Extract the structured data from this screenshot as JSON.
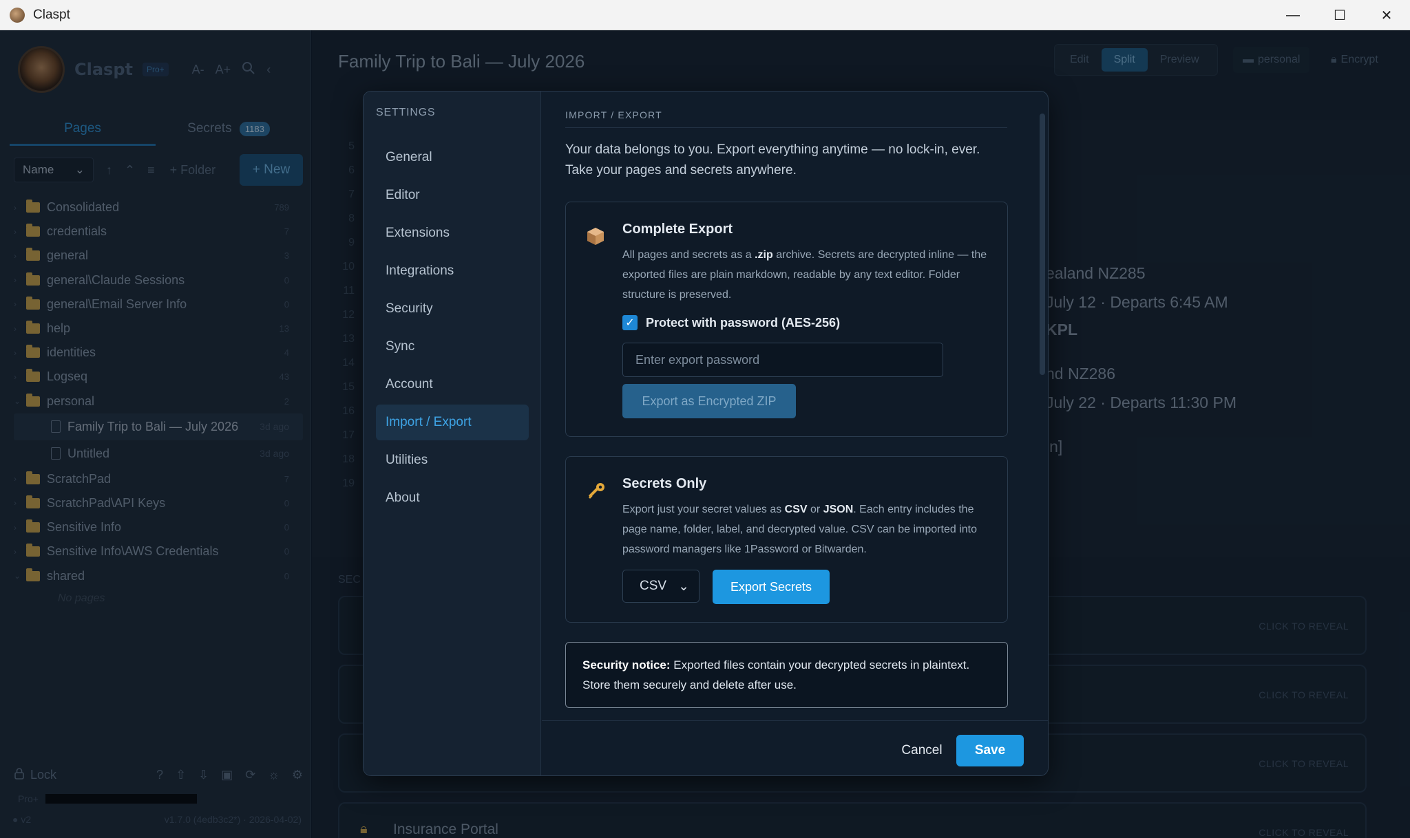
{
  "window": {
    "title": "Claspt",
    "controls": [
      "—",
      "☐",
      "✕"
    ]
  },
  "sidebar": {
    "brand": "Claspt",
    "plan_badge": "Pro+",
    "font_smaller": "A-",
    "font_larger": "A+",
    "tabs": [
      {
        "label": "Pages"
      },
      {
        "label": "Secrets",
        "count": "1183"
      }
    ],
    "sort": {
      "value": "Name"
    },
    "folder_label": "+ Folder",
    "new_label": "+ New",
    "folders": [
      {
        "name": "Consolidated",
        "count": "789"
      },
      {
        "name": "credentials",
        "count": "7"
      },
      {
        "name": "general",
        "count": "3"
      },
      {
        "name": "general\\Claude Sessions",
        "count": "0"
      },
      {
        "name": "general\\Email Server Info",
        "count": "0"
      },
      {
        "name": "help",
        "count": "13"
      },
      {
        "name": "identities",
        "count": "4"
      },
      {
        "name": "Logseq",
        "count": "43"
      },
      {
        "name": "personal",
        "count": "2"
      }
    ],
    "personal_pages": [
      {
        "name": "Family Trip to Bali — July 2026",
        "age": "3d ago"
      },
      {
        "name": "Untitled",
        "age": "3d ago"
      }
    ],
    "folders_after": [
      {
        "name": "ScratchPad",
        "count": "7"
      },
      {
        "name": "ScratchPad\\API Keys",
        "count": "0"
      },
      {
        "name": "Sensitive Info",
        "count": "0"
      },
      {
        "name": "Sensitive Info\\AWS Credentials",
        "count": "0"
      },
      {
        "name": "shared",
        "count": "0"
      }
    ],
    "empty_label": "No pages",
    "lock_label": "Lock",
    "pro_label": "Pro+",
    "vault_label": "v2",
    "version": "v1.7.0 (4edb3c2*) · 2026-04-02)"
  },
  "main": {
    "doc_title": "Family Trip to Bali — July 2026",
    "modes": [
      "Edit",
      "Split",
      "Preview"
    ],
    "active_mode": "Split",
    "folder_chip": "personal",
    "encrypt_label": "Encrypt",
    "line_numbers": [
      "5",
      "6",
      "7",
      "8",
      "9",
      "10",
      "11",
      "12",
      "13",
      "14",
      "15",
      "16",
      "17",
      "18",
      "19"
    ],
    "preview_lines": [
      "ealand NZ285",
      "July 12 · Departs 6:45 AM",
      "KPL",
      "nd NZ286",
      "July 22 · Departs 11:30 PM",
      "in]"
    ],
    "secrets_heading": "SEC",
    "reveal_label": "CLICK TO REVEAL",
    "last_secret_title": "Insurance Portal"
  },
  "modal": {
    "nav_heading": "SETTINGS",
    "nav_items": [
      "General",
      "Editor",
      "Extensions",
      "Integrations",
      "Security",
      "Sync",
      "Account",
      "Import / Export",
      "Utilities",
      "About"
    ],
    "active_item": "Import / Export",
    "section_label": "IMPORT / EXPORT",
    "intro_line1": "Your data belongs to you. Export everything anytime — no lock-in, ever.",
    "intro_line2": "Take your pages and secrets anywhere.",
    "complete_export": {
      "title": "Complete Export",
      "desc_a": "All pages and secrets as a ",
      "desc_b": ".zip",
      "desc_c": " archive. Secrets are decrypted inline — the exported files are plain markdown, readable by any text editor. Folder structure is preserved.",
      "checkbox_label": "Protect with password (AES-256)",
      "password_placeholder": "Enter export password",
      "button_label": "Export as Encrypted ZIP"
    },
    "secrets_only": {
      "title": "Secrets Only",
      "desc_a": "Export just your secret values as ",
      "desc_b": "CSV",
      "desc_c": " or ",
      "desc_d": "JSON",
      "desc_e": ". Each entry includes the page name, folder, label, and decrypted value. CSV can be imported into password managers like 1Password or Bitwarden.",
      "format_value": "CSV",
      "button_label": "Export Secrets"
    },
    "notice": {
      "bold": "Security notice:",
      "text": " Exported files contain your decrypted secrets in plaintext. Store them securely and delete after use."
    },
    "cancel_label": "Cancel",
    "save_label": "Save"
  },
  "colors": {
    "accent": "#1d97e0",
    "background": "#0f1a28",
    "folder": "#c9a24a"
  }
}
